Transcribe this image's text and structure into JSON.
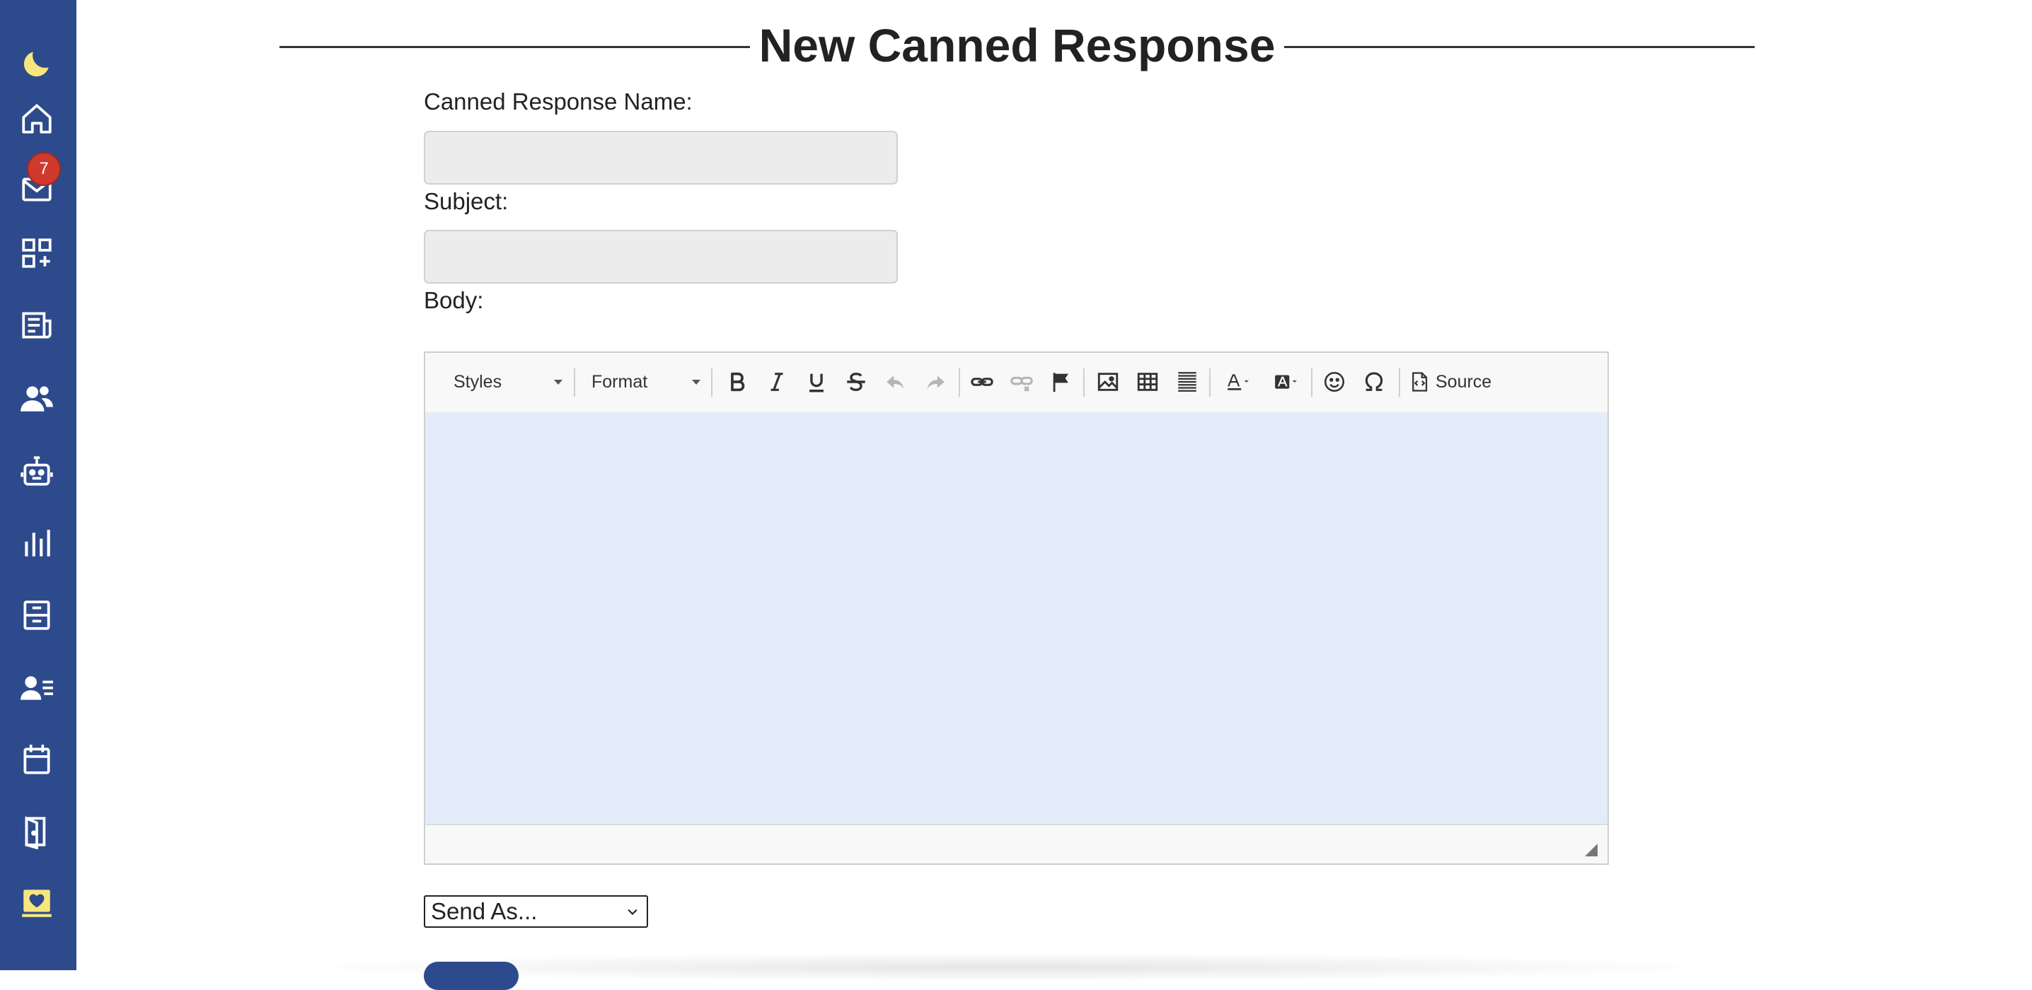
{
  "page": {
    "title": "New Canned Response"
  },
  "sidebar": {
    "items": [
      {
        "name": "theme-toggle",
        "icon": "moon-icon"
      },
      {
        "name": "home",
        "icon": "home-icon"
      },
      {
        "name": "inbox",
        "icon": "mail-icon",
        "badge": "7"
      },
      {
        "name": "apps",
        "icon": "apps-add-icon"
      },
      {
        "name": "articles",
        "icon": "article-icon"
      },
      {
        "name": "users",
        "icon": "users-icon"
      },
      {
        "name": "bots",
        "icon": "robot-icon"
      },
      {
        "name": "reports",
        "icon": "bar-chart-icon"
      },
      {
        "name": "archive",
        "icon": "archive-icon"
      },
      {
        "name": "contacts",
        "icon": "contact-list-icon"
      },
      {
        "name": "calendar",
        "icon": "calendar-icon"
      },
      {
        "name": "logout",
        "icon": "door-icon"
      },
      {
        "name": "favorites",
        "icon": "heart-screen-icon"
      }
    ],
    "accent": "#f7e67d",
    "background": "#2d4a8c"
  },
  "form": {
    "name_label": "Canned Response Name:",
    "name_value": "",
    "subject_label": "Subject:",
    "subject_value": "",
    "body_label": "Body:",
    "send_as": {
      "selected": "Send As..."
    }
  },
  "editor": {
    "styles_label": "Styles",
    "format_label": "Format",
    "source_label": "Source",
    "tools": [
      "bold-icon",
      "italic-icon",
      "underline-icon",
      "strikethrough-icon",
      "undo-icon",
      "redo-icon",
      "link-icon",
      "unlink-icon",
      "anchor-flag-icon",
      "image-icon",
      "table-icon",
      "horizontal-line-icon",
      "text-color-icon",
      "background-color-icon",
      "smiley-icon",
      "special-char-omega-icon",
      "source-icon"
    ]
  }
}
